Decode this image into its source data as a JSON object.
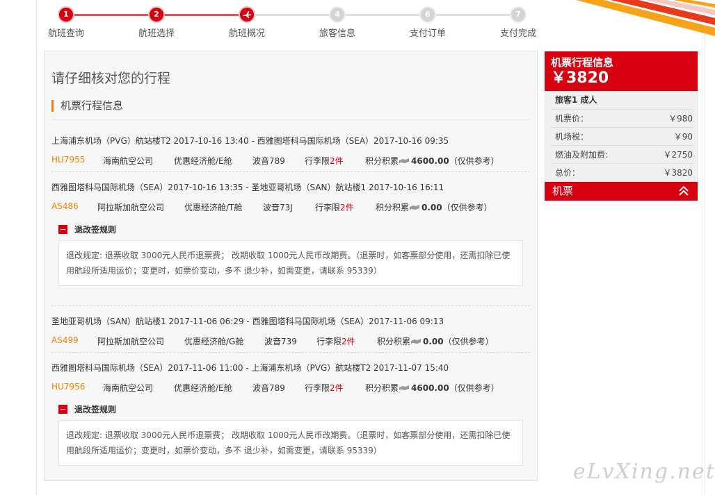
{
  "stepper": {
    "steps": [
      {
        "num": "1",
        "label": "航班查询",
        "state": "done"
      },
      {
        "num": "2",
        "label": "航班选择",
        "state": "done"
      },
      {
        "num": "",
        "label": "航班概况",
        "state": "current",
        "icon": "plane-icon"
      },
      {
        "num": "4",
        "label": "旅客信息",
        "state": "todo"
      },
      {
        "num": "6",
        "label": "支付订单",
        "state": "todo"
      },
      {
        "num": "7",
        "label": "支付完成",
        "state": "todo"
      }
    ]
  },
  "main": {
    "title": "请仔细核对您的行程",
    "section_title": "机票行程信息",
    "segments": [
      {
        "route": "上海浦东机场（PVG）航站楼T2 2017-10-16 13:40 - 西雅图塔科马国际机场（SEA）2017-10-16 09:35",
        "flight_no": "HU7955",
        "airline": "海南航空公司",
        "cabin": "优惠经济舱/E舱",
        "aircraft": "波音789",
        "baggage_label": "行李限",
        "baggage_value": "2件",
        "points_label": "积分积累",
        "points_value": "4600.00",
        "points_note": "（仅供参考）"
      },
      {
        "route": "西雅图塔科马国际机场（SEA）2017-10-16 13:35 - 圣地亚哥机场（SAN）航站楼1 2017-10-16 16:11",
        "flight_no": "AS486",
        "airline": "阿拉斯加航空公司",
        "cabin": "优惠经济舱/T舱",
        "aircraft": "波音73J",
        "baggage_label": "行李限",
        "baggage_value": "2件",
        "points_label": "积分积累",
        "points_value": "0.00",
        "points_note": "（仅供参考）"
      },
      {
        "route": "圣地亚哥机场（SAN）航站楼1 2017-11-06 06:29 - 西雅图塔科马国际机场（SEA）2017-11-06 09:13",
        "flight_no": "AS499",
        "airline": "阿拉斯加航空公司",
        "cabin": "优惠经济舱/G舱",
        "aircraft": "波音739",
        "baggage_label": "行李限",
        "baggage_value": "2件",
        "points_label": "积分积累",
        "points_value": "0.00",
        "points_note": "（仅供参考）"
      },
      {
        "route": "西雅图塔科马国际机场（SEA）2017-11-06 11:00 - 上海浦东机场（PVG）航站楼T2 2017-11-07 15:40",
        "flight_no": "HU7956",
        "airline": "海南航空公司",
        "cabin": "优惠经济舱/E舱",
        "aircraft": "波音789",
        "baggage_label": "行李限",
        "baggage_value": "2件",
        "points_label": "积分积累",
        "points_value": "4600.00",
        "points_note": "（仅供参考）"
      }
    ],
    "rules": [
      {
        "title": "退改签规则",
        "text": "退改规定: 退票收取 3000元人民币退票费； 改期收取 1000元人民币改期费。（退票时，如客票部分使用，还需扣除已使用航段所适用运价；变更时，如票价变动，多不 退少补，如需变更，请联系 95339）"
      },
      {
        "title": "退改签规则",
        "text": "退改规定: 退票收取 3000元人民币退票费； 改期收取 1000元人民币改期费。（退票时，如客票部分使用，还需扣除已使用航段所适用运价；变更时，如票价变动，多不 退少补，如需变更，请联系 95339）"
      }
    ]
  },
  "side": {
    "title": "机票行程信息",
    "total_big": "￥3820",
    "passenger": "旅客1  成人",
    "rows": [
      {
        "label": "机票价：",
        "value": "￥980"
      },
      {
        "label": "机场税：",
        "value": "￥90"
      },
      {
        "label": "燃油及附加费:",
        "value": "￥2750"
      },
      {
        "label": "总价：",
        "value": "￥3820"
      }
    ],
    "footer_label": "机票"
  },
  "watermark": "eLvXing.net",
  "colors": {
    "brand_red": "#d7000f",
    "accent_orange": "#f08300"
  }
}
